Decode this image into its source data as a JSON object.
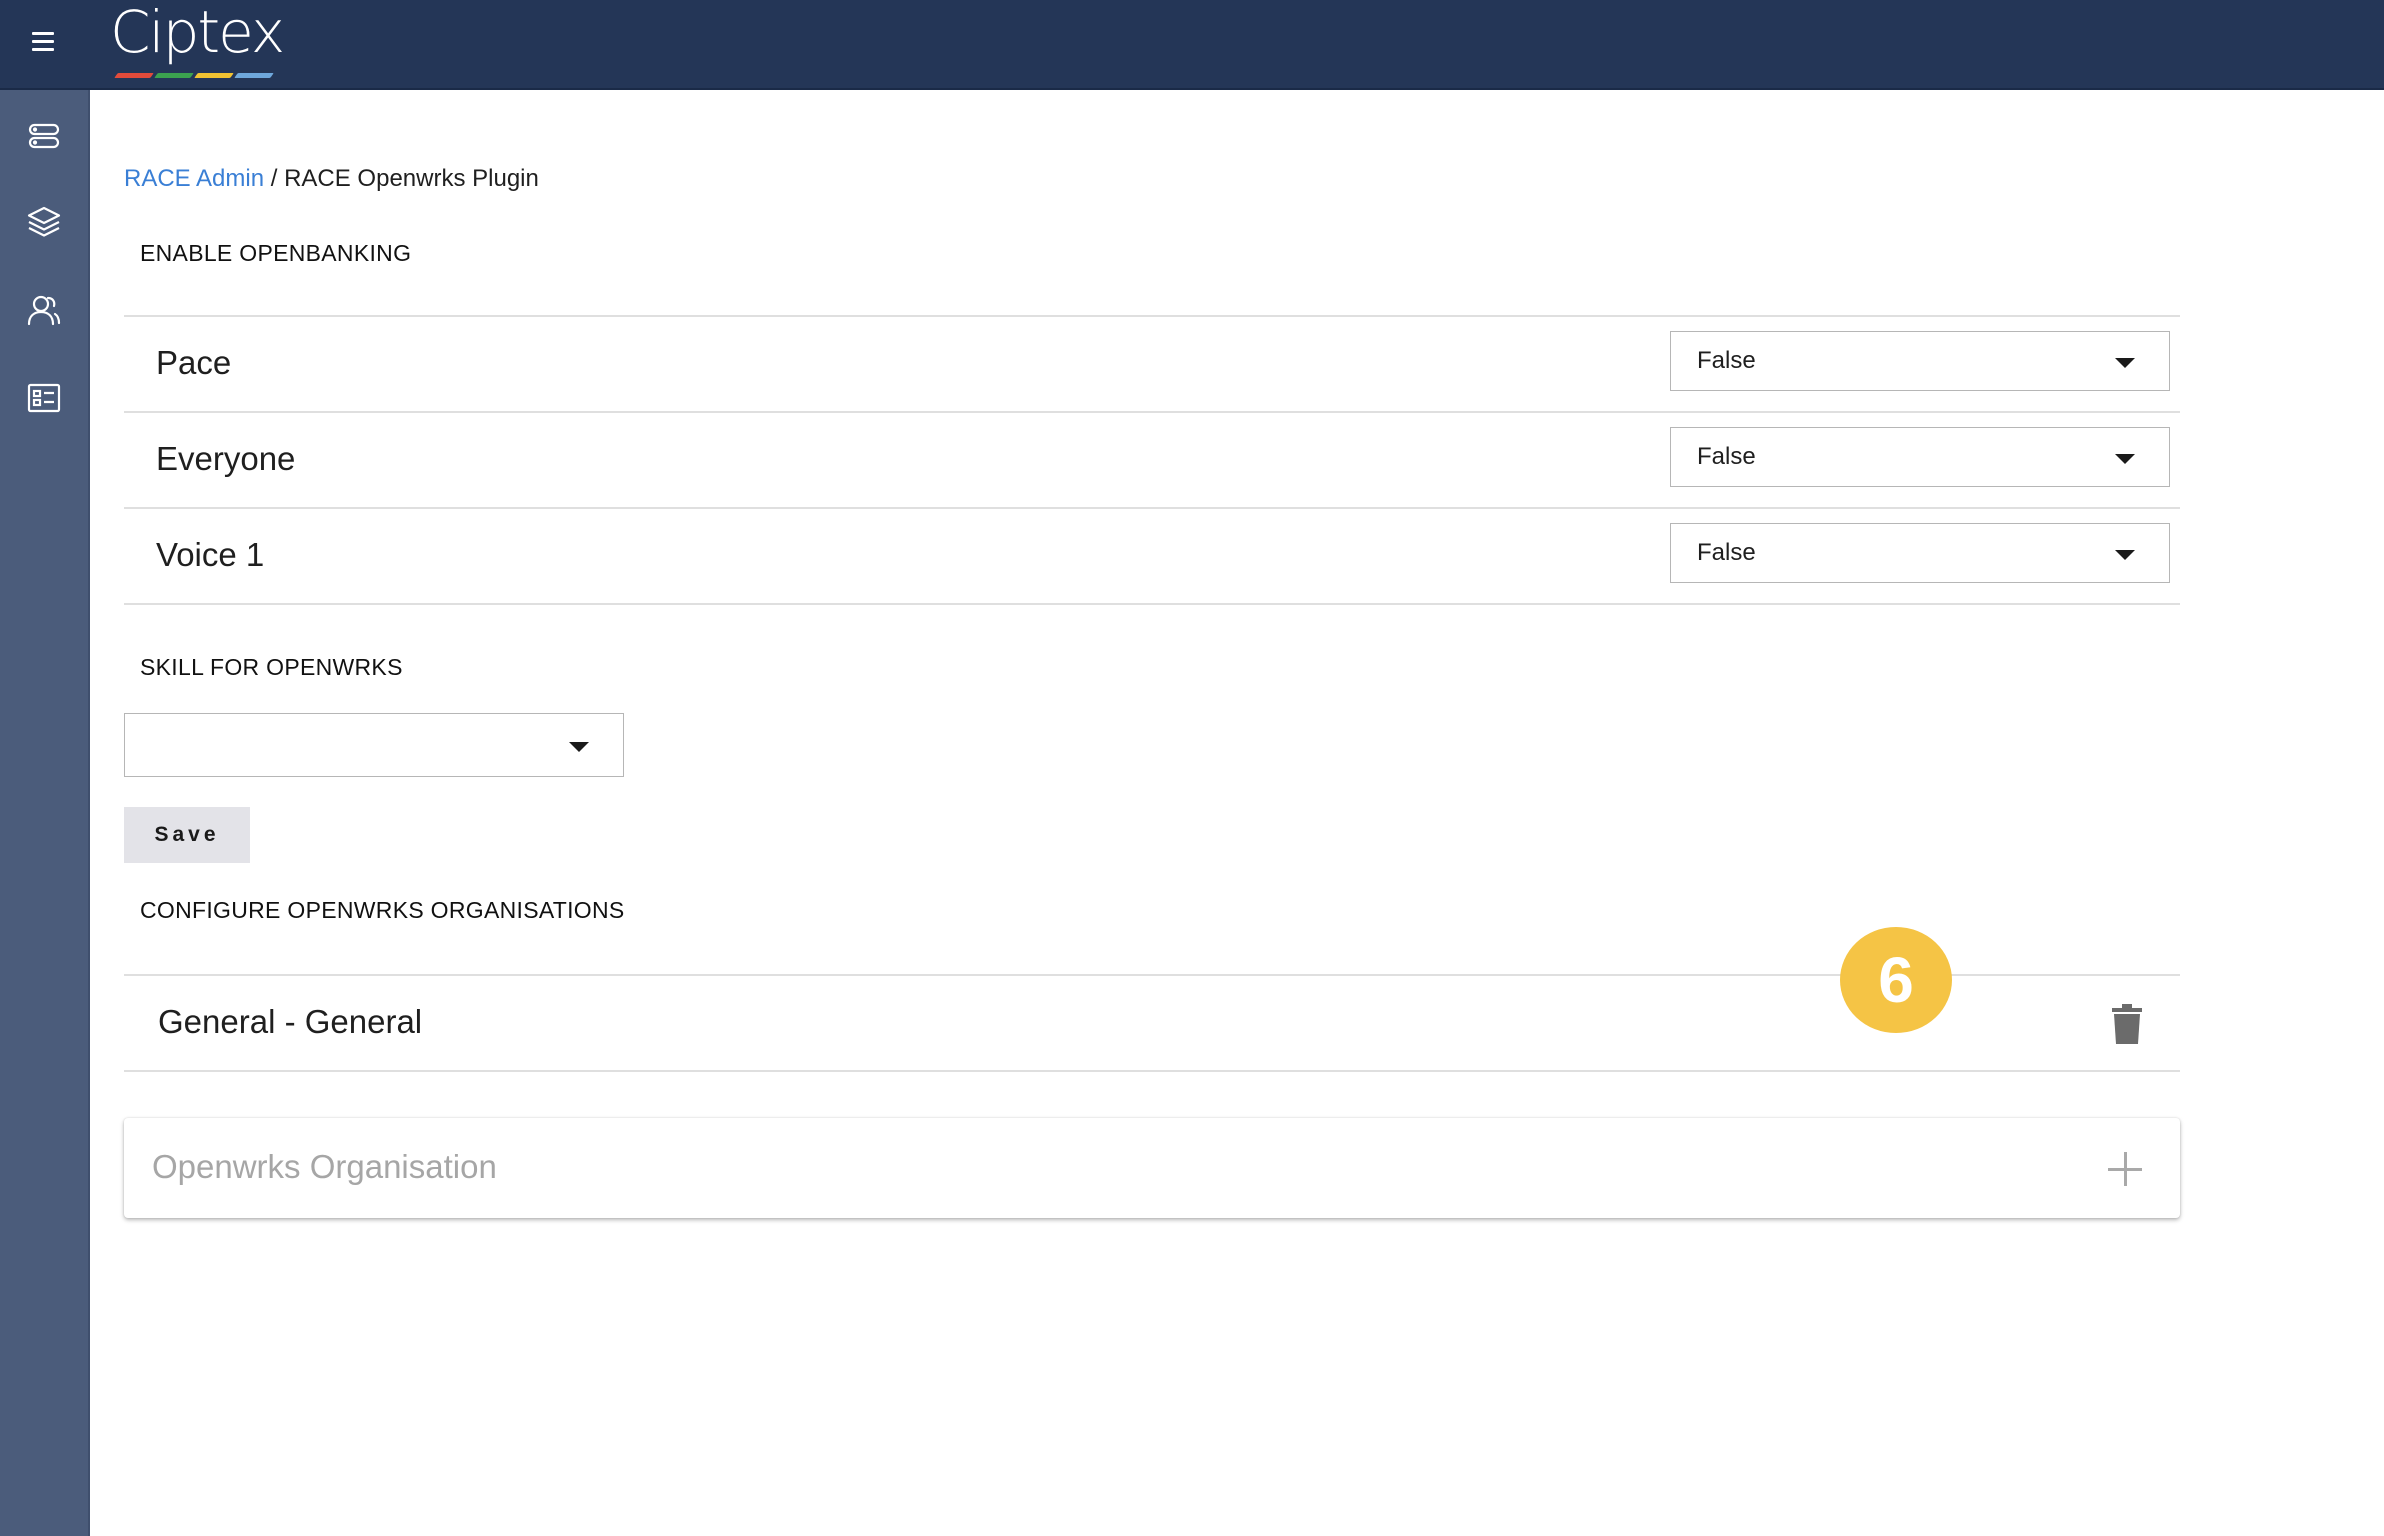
{
  "brand": {
    "name": "Ciptex",
    "stripe_colors": [
      "#e24b3b",
      "#3ba24f",
      "#f1c232",
      "#6fa8dc"
    ]
  },
  "topbar": {
    "menu_icon": "hamburger-icon"
  },
  "sidebar": {
    "items": [
      {
        "icon": "server-icon"
      },
      {
        "icon": "layers-icon"
      },
      {
        "icon": "users-icon"
      },
      {
        "icon": "contact-card-icon"
      }
    ]
  },
  "breadcrumb": {
    "parent": "RACE Admin",
    "separator": " / ",
    "current": "RACE Openwrks Plugin"
  },
  "enable_section": {
    "title": "ENABLE OPENBANKING",
    "rows": [
      {
        "label": "Pace",
        "value": "False"
      },
      {
        "label": "Everyone",
        "value": "False"
      },
      {
        "label": "Voice 1",
        "value": "False"
      }
    ]
  },
  "skill_section": {
    "title": "SKILL FOR OPENWRKS",
    "selected": ""
  },
  "save_label": "Save",
  "orgs_section": {
    "title": "CONFIGURE OPENWRKS ORGANISATIONS",
    "items": [
      {
        "label": "General - General"
      }
    ],
    "add_placeholder": "Openwrks Organisation"
  },
  "step_badge": "6",
  "colors": {
    "topbar": "#243657",
    "sidebar": "#4b5c7b",
    "link": "#3a7fd5",
    "badge": "#f5c445"
  }
}
